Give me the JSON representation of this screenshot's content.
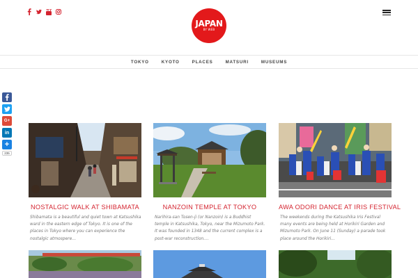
{
  "header": {
    "social_icons": [
      "facebook-icon",
      "twitter-icon",
      "youtube-icon",
      "instagram-icon"
    ],
    "logo_main": "JAPAN",
    "logo_sub": "BY WEB",
    "logo_color": "#e3191b"
  },
  "nav": {
    "items": [
      "TOKYO",
      "KYOTO",
      "PLACES",
      "MATSURI",
      "MUSEUMS"
    ]
  },
  "share": {
    "buttons": [
      "facebook-icon",
      "twitter-icon",
      "googleplus-icon",
      "linkedin-icon",
      "share-icon"
    ],
    "count": "235",
    "colors": {
      "facebook": "#3b5998",
      "twitter": "#1da1f2",
      "googleplus": "#dd4b39",
      "linkedin": "#0077b5",
      "share": "#1a82e2"
    }
  },
  "cards": [
    {
      "title": "NOSTALGIC WALK AT SHIBAMATA",
      "excerpt": "Shibamata is a beautiful and quiet town at Katsushika ward in the eastern edge of Tokyo. It is one of the places in Tokyo where you can experience the nostalgic atmospere…"
    },
    {
      "title": "NANZOIN TEMPLE AT TOKYO",
      "excerpt": "Narihira-san Tosen-ji (or Nanzoin) is a Buddhist temple in Katsushika, Tokyo, near the Mizumoto Park. It was founded in 1348 and the current complex is a post-war reconstruction.…"
    },
    {
      "title": "AWA ODORI DANCE AT IRIS FESTIVAL",
      "excerpt": "The weekends during the Katsushika Iris Festival many events are being held at Horikiri Garden and Mizumoto Park.  On June 11 (Sunday) a parade took place around the Horikiri…"
    }
  ],
  "accent_color": "#d4232f"
}
